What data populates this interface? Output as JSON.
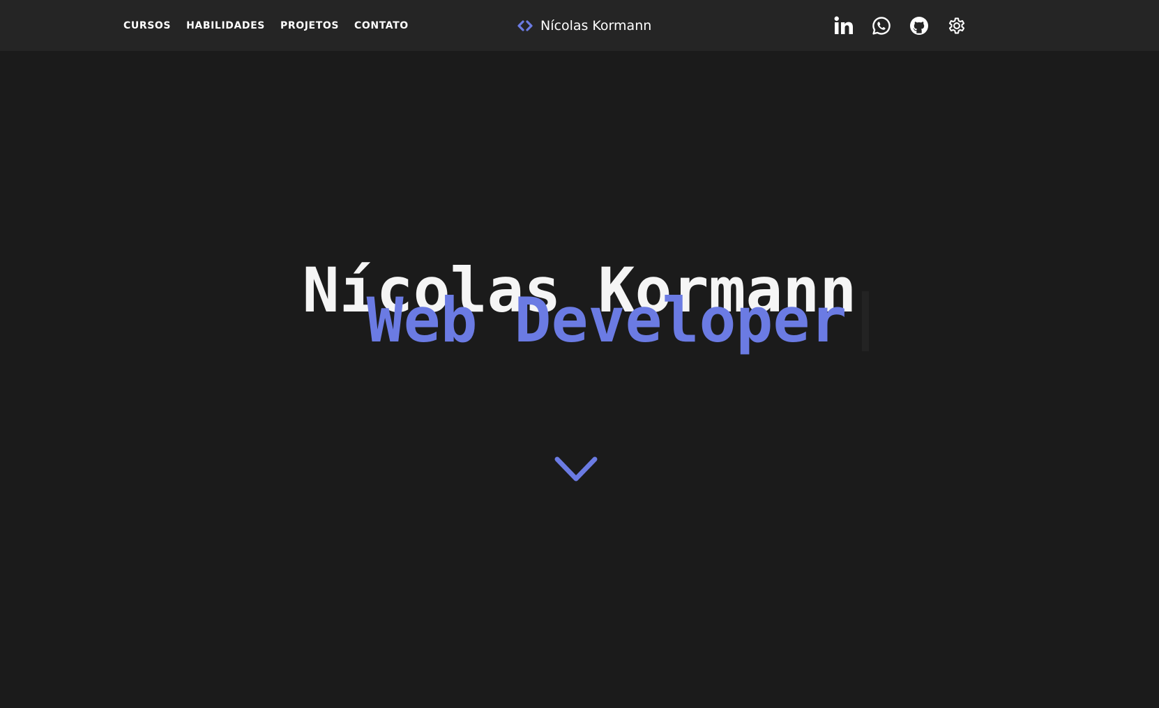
{
  "header": {
    "nav": [
      {
        "label": "CURSOS"
      },
      {
        "label": "HABILIDADES"
      },
      {
        "label": "PROJETOS"
      },
      {
        "label": "CONTATO"
      }
    ],
    "brand": {
      "name": "Nícolas Kormann",
      "icon": "code-brackets-icon"
    },
    "socials": [
      {
        "icon": "linkedin-icon"
      },
      {
        "icon": "whatsapp-icon"
      },
      {
        "icon": "github-icon"
      },
      {
        "icon": "gear-icon"
      }
    ]
  },
  "hero": {
    "name": "Nícolas Kormann",
    "role": "Web Developer",
    "scroll_icon": "chevron-down-icon"
  },
  "colors": {
    "background": "#1b1b1b",
    "header_background": "#252525",
    "accent": "#6b7be3",
    "text": "#ffffff"
  }
}
